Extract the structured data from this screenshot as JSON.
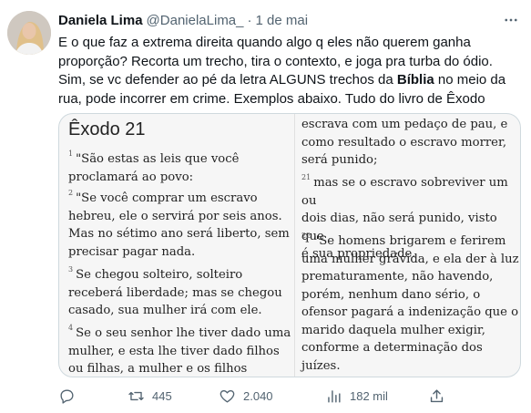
{
  "tweet": {
    "author_name": "Daniela Lima",
    "handle": "@DanielaLima_",
    "separator": "·",
    "date": "1 de mai",
    "text_lines": [
      "E o que faz a extrema direita quando algo q eles não querem ganha",
      "proporção? Recorta um trecho, tira o contexto, e joga pra turba do ódio.",
      "Sim, se vc defender ao pé da letra ALGUNS trechos da ",
      "Bíblia",
      " no meio da",
      "rua, pode incorrer em crime. Exemplos abaixo. Tudo do livro de Êxodo"
    ]
  },
  "media": {
    "chapter_title": "Êxodo 21",
    "left_paragraphs": [
      {
        "verse": "1",
        "text": "\"São estas as leis que você\nproclamará ao povo:"
      },
      {
        "verse": "2",
        "text": "\"Se você comprar um escravo\nhebreu, ele o servirá por seis anos.\nMas no sétimo ano será liberto, sem\nprecisar pagar nada."
      },
      {
        "verse": "3",
        "text": "Se chegou solteiro, solteiro\nreceberá liberdade; mas se chegou\ncasado, sua mulher irá com ele."
      },
      {
        "verse": "4",
        "text": "Se o seu senhor lhe tiver dado uma\nmulher, e esta lhe tiver dado filhos\nou filhas, a mulher e os filhos"
      }
    ],
    "right_paragraphs": [
      {
        "verse": "",
        "text": "escrava com um pedaço de pau, e\ncomo resultado o escravo morrer,\nserá punido;"
      },
      {
        "verse": "21",
        "text": "mas se o escravo sobreviver um ou\ndois dias, não será punido, visto que\né sua propriedade."
      },
      {
        "verse": "22",
        "text": "\"Se homens brigarem e ferirem\numa mulher grávida, e ela der à luz\nprematuramente, não havendo,\nporém, nenhum dano sério, o\nofensor pagará a indenização que o\nmarido daquela mulher exigir,\nconforme a determinação dos\njuízes."
      }
    ]
  },
  "actions": {
    "reply_icon": "reply-icon",
    "retweet_icon": "retweet-icon",
    "retweets": "445",
    "like_icon": "heart-icon",
    "likes": "2.040",
    "views_icon": "views-icon",
    "views": "182 mil",
    "share_icon": "share-icon"
  },
  "colors": {
    "text": "#0f1419",
    "secondary": "#536471",
    "border": "#cfd9de"
  }
}
